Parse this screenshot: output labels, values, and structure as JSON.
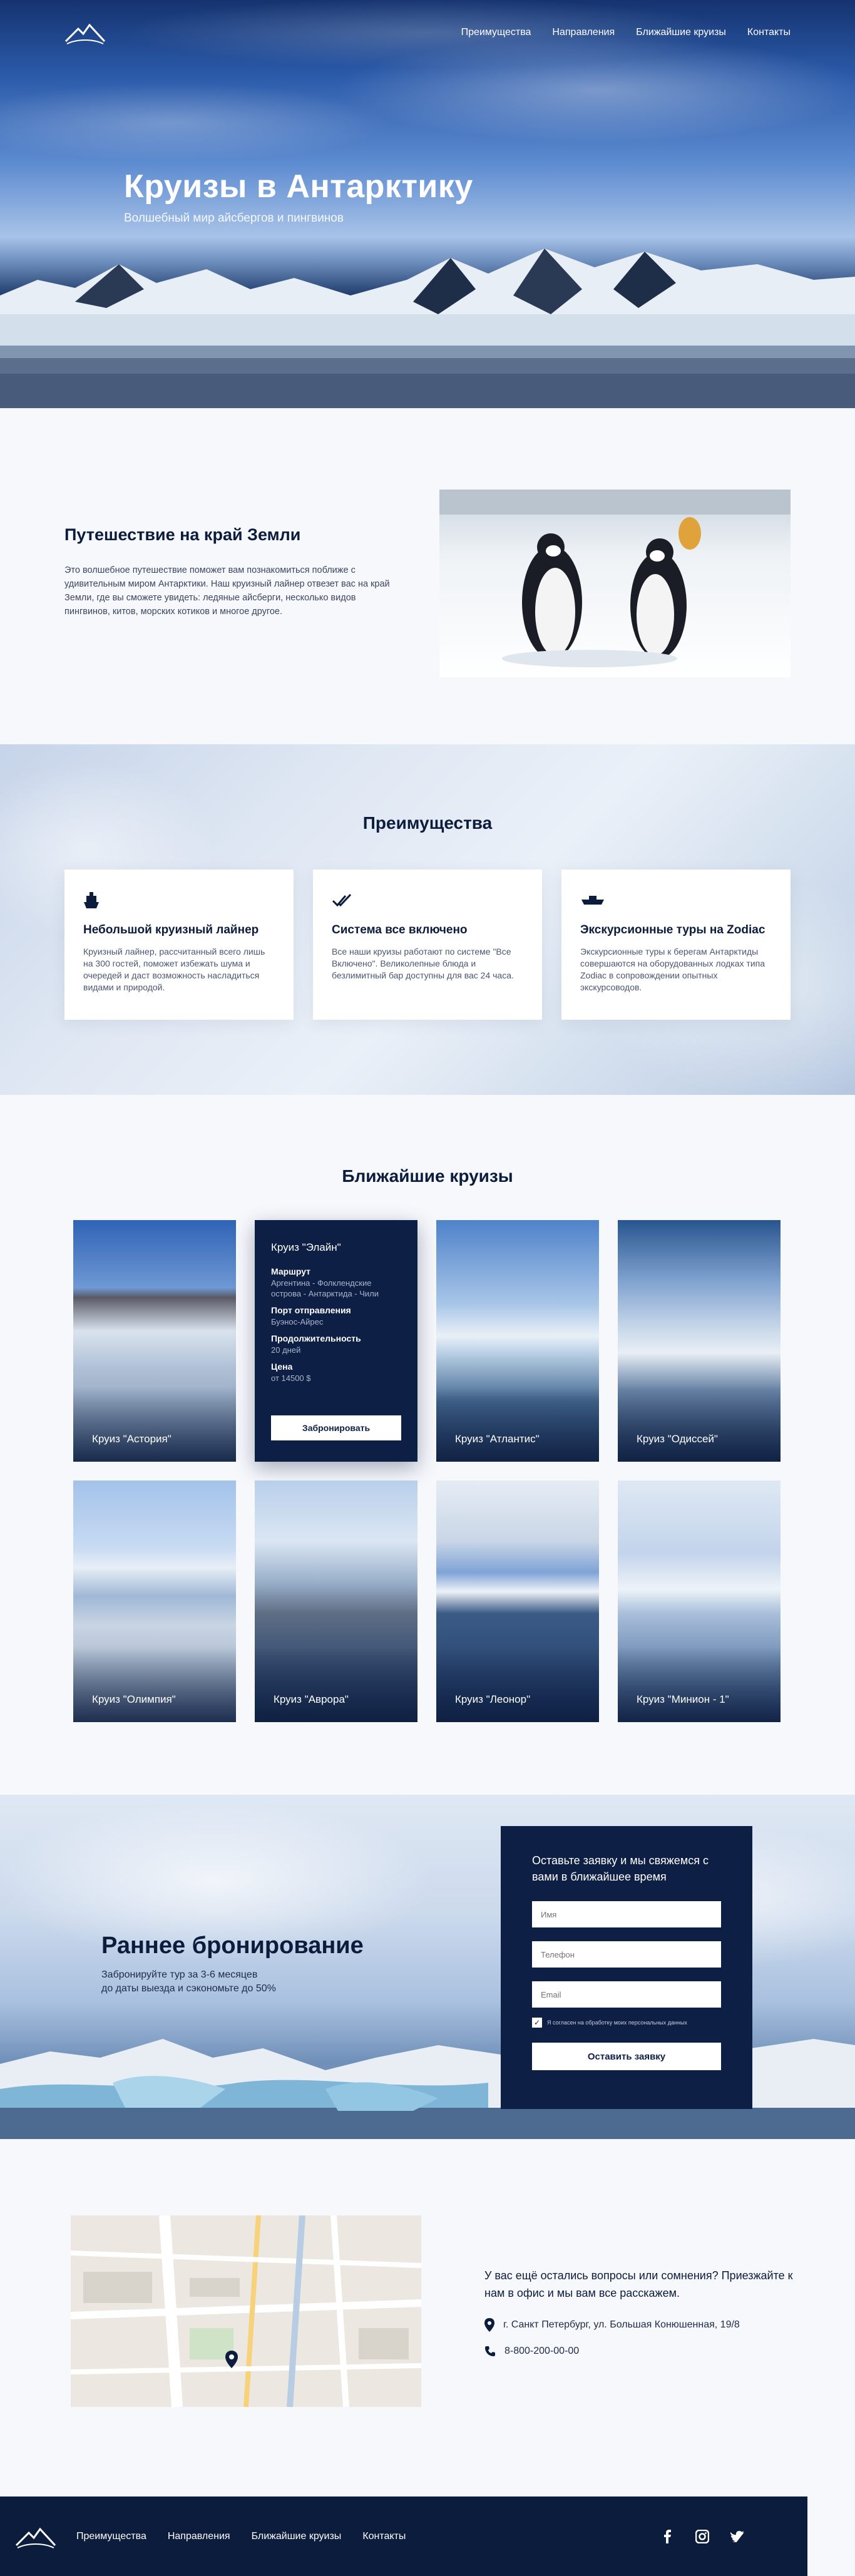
{
  "nav": {
    "items": [
      "Преимущества",
      "Направления",
      "Ближайшие круизы",
      "Контакты"
    ]
  },
  "hero": {
    "title": "Круизы в Антарктику",
    "subtitle": "Волшебный мир айсбергов и пингвинов"
  },
  "about": {
    "title": "Путешествие на край Земли",
    "text": "Это волшебное путешествие поможет вам познакомиться поближе с удивительным миром Антарктики. Наш круизный лайнер отвезет вас на край Земли, где вы сможете увидеть: ледяные айсберги, несколько видов пингвинов, китов, морских котиков и многое другое."
  },
  "advantages": {
    "title": "Преимущества",
    "cards": [
      {
        "icon": "ship-icon",
        "title": "Небольшой круизный лайнер",
        "text": "Круизный лайнер, рассчитанный всего лишь на 300 гостей, поможет избежать шума и очередей и даст возможность насладиться видами и природой."
      },
      {
        "icon": "double-check-icon",
        "title": "Система все включено",
        "text": "Все наши круизы работают по системе \"Все Включено\". Великолепные блюда и безлимитный бар доступны для вас 24 часа."
      },
      {
        "icon": "boat-icon",
        "title": "Экскурсионные туры на Zodiac",
        "text": "Экскурсионные туры к берегам Антарктиды совершаются на оборудованных лодках типа Zodiac в сопровождении опытных экскурсоводов."
      }
    ]
  },
  "cruises": {
    "title": "Ближайшие круизы",
    "items": [
      {
        "name": "Круиз \"Астория\""
      },
      {
        "name": "Круиз \"Элайн\""
      },
      {
        "name": "Круиз \"Атлантис\""
      },
      {
        "name": "Круиз \"Одиссей\""
      },
      {
        "name": "Круиз \"Олимпия\""
      },
      {
        "name": "Круиз \"Аврора\""
      },
      {
        "name": "Круиз \"Леонор\""
      },
      {
        "name": "Круиз \"Минион - 1\""
      }
    ],
    "detail": {
      "title": "Круиз \"Элайн\"",
      "route_label": "Маршрут",
      "route": "Аргентина - Фолклендские острова - Антарктида - Чили",
      "port_label": "Порт отправления",
      "port": "Буэнос-Айрес",
      "duration_label": "Продолжительность",
      "duration": "20 дней",
      "price_label": "Цена",
      "price": "от 14500 $",
      "button": "Забронировать"
    }
  },
  "early": {
    "title": "Раннее бронирование",
    "text_line1": "Забронируйте тур за 3-6 месяцев",
    "text_line2": "до даты выезда и сэкономьте до 50%",
    "form": {
      "title": "Оставьте заявку и мы свяжемся с вами в ближайшее время",
      "name_placeholder": "Имя",
      "phone_placeholder": "Телефон",
      "email_placeholder": "Email",
      "consent": "Я согласен на обработку моих персональных данных",
      "submit": "Оставить заявку"
    }
  },
  "contacts": {
    "title": "У вас ещё остались вопросы или сомнения? Приезжайте к нам в офис и мы вам все расскажем.",
    "address": "г. Санкт Петербург, ул. Большая Конюшенная, 19/8",
    "phone": "8-800-200-00-00"
  },
  "footer": {
    "items": [
      "Преимущества",
      "Направления",
      "Ближайшие круизы",
      "Контакты"
    ],
    "socials": [
      "facebook-icon",
      "instagram-icon",
      "twitter-icon"
    ]
  }
}
